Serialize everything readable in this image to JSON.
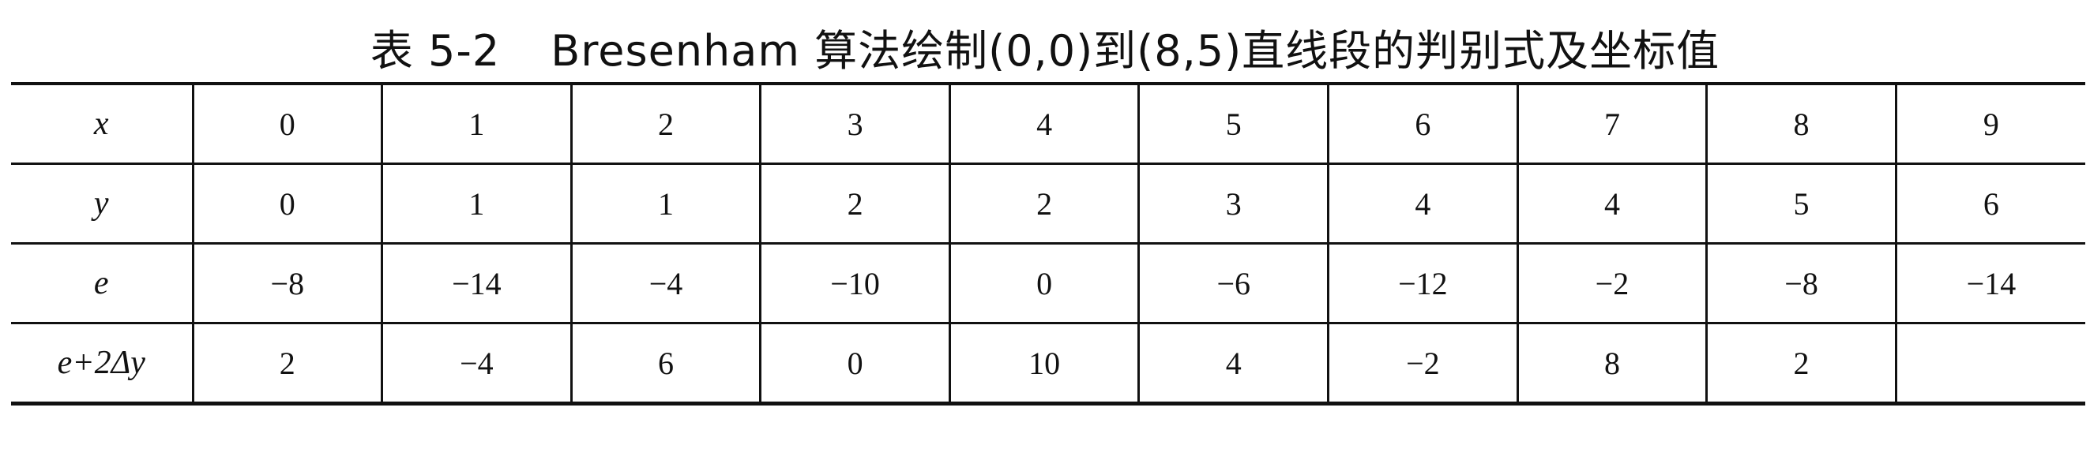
{
  "caption": {
    "number": "表 5-2",
    "text": "Bresenham 算法绘制(0,0)到(8,5)直线段的判别式及坐标值"
  },
  "table": {
    "rows": [
      {
        "label": "x",
        "values": [
          "0",
          "1",
          "2",
          "3",
          "4",
          "5",
          "6",
          "7",
          "8",
          "9"
        ]
      },
      {
        "label": "y",
        "values": [
          "0",
          "1",
          "1",
          "2",
          "2",
          "3",
          "4",
          "4",
          "5",
          "6"
        ]
      },
      {
        "label": "e",
        "values": [
          "−8",
          "−14",
          "−4",
          "−10",
          "0",
          "−6",
          "−12",
          "−2",
          "−8",
          "−14"
        ]
      },
      {
        "label": "e+2Δy",
        "values": [
          "2",
          "−4",
          "6",
          "0",
          "10",
          "4",
          "−2",
          "8",
          "2",
          ""
        ]
      }
    ]
  }
}
